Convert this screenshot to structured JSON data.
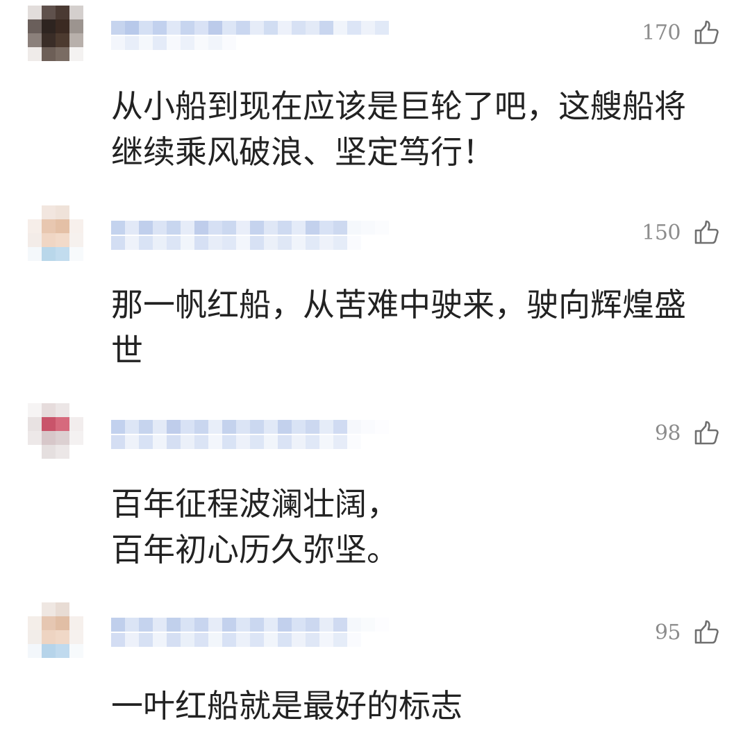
{
  "colors": {
    "text": "#222222",
    "like_count": "#8c8c8c",
    "username_blur": "#c9d7ee",
    "background": "#ffffff"
  },
  "comments": [
    {
      "likes": "170",
      "text": "从小船到现在应该是巨轮了吧，这艘船将\n继续乘风破浪、坚定笃行！"
    },
    {
      "likes": "150",
      "text": "那一帆红船，从苦难中驶来，驶向辉煌盛\n世"
    },
    {
      "likes": "98",
      "text": "百年征程波澜壮阔，\n百年初心历久弥坚。"
    },
    {
      "likes": "95",
      "text": "一叶红船就是最好的标志"
    }
  ],
  "icons": {
    "like": "thumbs-up-icon"
  }
}
